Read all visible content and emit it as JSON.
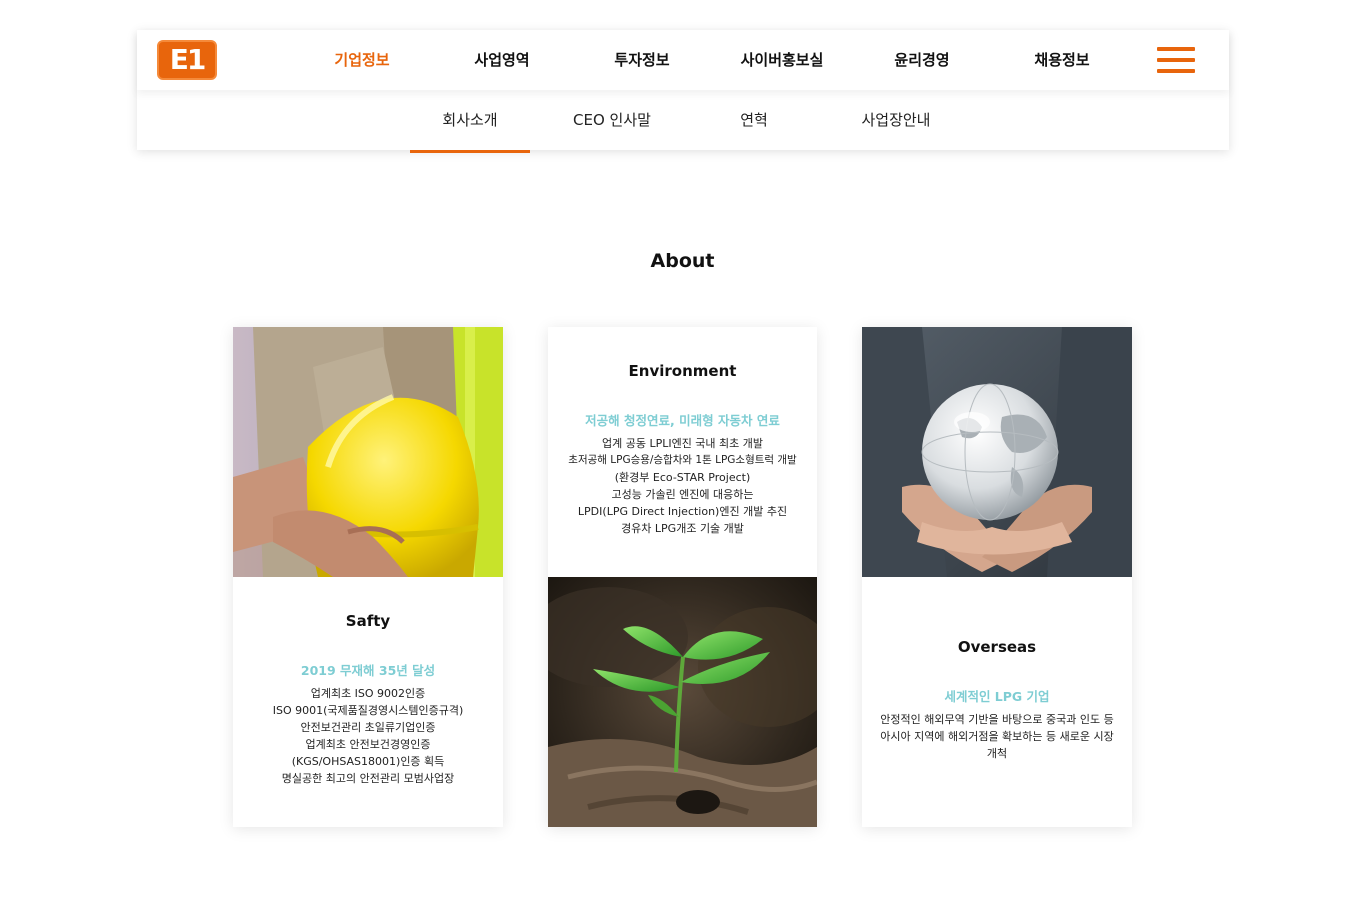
{
  "logo": {
    "text": "E1"
  },
  "gnb": {
    "items": [
      {
        "label": "기업정보",
        "active": true
      },
      {
        "label": "사업영역",
        "active": false
      },
      {
        "label": "투자정보",
        "active": false
      },
      {
        "label": "사이버홍보실",
        "active": false
      },
      {
        "label": "윤리경영",
        "active": false
      },
      {
        "label": "채용정보",
        "active": false
      }
    ],
    "menu_icon": "hamburger-menu-icon"
  },
  "subnav": {
    "items": [
      {
        "label": "회사소개",
        "active": true
      },
      {
        "label": "CEO 인사말",
        "active": false
      },
      {
        "label": "연혁",
        "active": false
      },
      {
        "label": "사업장안내",
        "active": false
      }
    ]
  },
  "section": {
    "title": "About"
  },
  "cards": [
    {
      "title": "Safty",
      "subtitle": "2019 무재해 35년 달성",
      "lines": [
        "업계최초 ISO 9002인증",
        "ISO 9001(국제품질경영시스템인증규격)",
        "안전보건관리 초일류기업인증",
        "업계최초 안전보건경영인증",
        "(KGS/OHSAS18001)인증 획득",
        "명실공한 최고의 안전관리 모범사업장"
      ],
      "image": "worker-holding-yellow-helmet"
    },
    {
      "title": "Environment",
      "subtitle": "저공해 청정연료, 미래형 자동차 연료",
      "lines": [
        "업계 공동 LPLI엔진 국내 최초 개발",
        "초저공해 LPG승용/승합차와 1톤 LPG소형트럭 개발",
        "(환경부 Eco-STAR Project)",
        "고성능 가솔린 엔진에 대응하는",
        "LPDI(LPG Direct Injection)엔진 개발 추진",
        "경유차 LPG개조 기술 개발"
      ],
      "image": "green-sprout-on-log"
    },
    {
      "title": "Overseas",
      "subtitle": "세계적인 LPG 기업",
      "lines": [
        "안정적인 해외무역 기반을 바탕으로 중국과 인도 등 아시아 지역에 해외거점을 확보하는 등 새로운 시장 개척"
      ],
      "image": "hands-holding-glass-globe"
    }
  ],
  "colors": {
    "accent": "#e8650c",
    "subtitle": "#7ecdd3"
  }
}
